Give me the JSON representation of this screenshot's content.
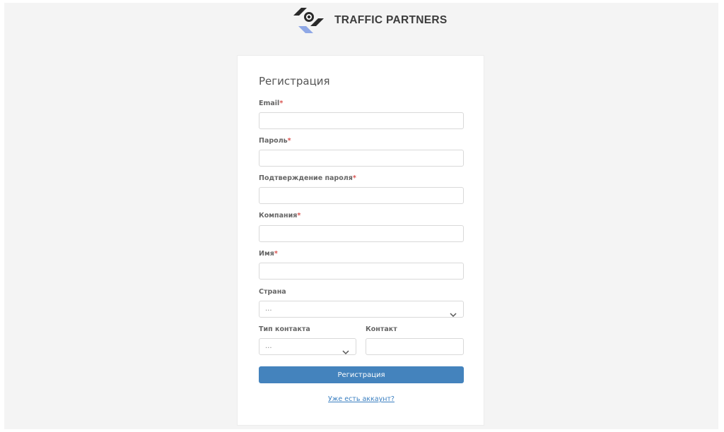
{
  "brand": {
    "name": "TRAFFIC PARTNERS",
    "colors": {
      "dark": "#2b2b2b",
      "accent": "#8fa8e6"
    }
  },
  "form": {
    "title": "Регистрация",
    "required_mark": "*",
    "fields": {
      "email": {
        "label": "Email",
        "value": "",
        "placeholder": ""
      },
      "password": {
        "label": "Пароль",
        "value": "",
        "placeholder": ""
      },
      "password_confirm": {
        "label": "Подтверждение пароля",
        "value": "",
        "placeholder": ""
      },
      "company": {
        "label": "Компания",
        "value": "",
        "placeholder": ""
      },
      "name": {
        "label": "Имя",
        "value": "",
        "placeholder": ""
      },
      "country": {
        "label": "Страна",
        "selected": "..."
      },
      "contact_type": {
        "label": "Тип контакта",
        "selected": "..."
      },
      "contact": {
        "label": "Контакт",
        "value": "",
        "placeholder": ""
      }
    },
    "submit_label": "Регистрация",
    "login_link": "Уже есть аккаунт?"
  },
  "colors": {
    "page_background": "#f4f4f4",
    "card_background": "#ffffff",
    "primary_button": "#4483bd",
    "link": "#3a7fc1",
    "required": "#d9534f"
  },
  "icons": {
    "brand_logo": "traffic-partners-logo-icon",
    "select_arrow": "chevron-down-icon"
  }
}
